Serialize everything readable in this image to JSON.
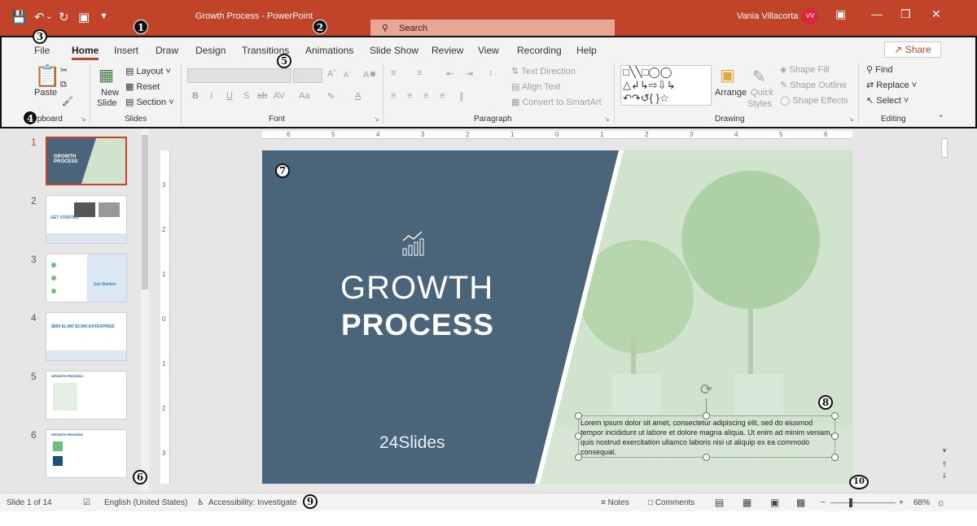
{
  "titlebar": {
    "doc_title": "Growth Process  -  PowerPoint",
    "search_placeholder": "Search",
    "user_name": "Vania Villacorta",
    "user_initials": "VV"
  },
  "badges": [
    "1",
    "2",
    "3",
    "4",
    "5",
    "6",
    "7",
    "8",
    "9",
    "10"
  ],
  "ribbon": {
    "tabs": [
      "File",
      "Home",
      "Insert",
      "Draw",
      "Design",
      "Transitions",
      "Animations",
      "Slide Show",
      "Review",
      "View",
      "Recording",
      "Help"
    ],
    "active_tab": "Home",
    "share_label": "Share",
    "clipboard": {
      "paste": "Paste",
      "group": "Clipboard"
    },
    "slides": {
      "new_slide_1": "New",
      "new_slide_2": "Slide",
      "layout": "Layout",
      "reset": "Reset",
      "section": "Section",
      "group": "Slides"
    },
    "font": {
      "group": "Font"
    },
    "paragraph": {
      "text_direction": "Text Direction",
      "align_text": "Align Text",
      "convert_smartart": "Convert to SmartArt",
      "group": "Paragraph"
    },
    "drawing": {
      "arrange": "Arrange",
      "quick_styles_1": "Quick",
      "quick_styles_2": "Styles",
      "shape_fill": "Shape Fill",
      "shape_outline": "Shape Outline",
      "shape_effects": "Shape Effects",
      "group": "Drawing"
    },
    "editing": {
      "find": "Find",
      "replace": "Replace",
      "select": "Select",
      "group": "Editing"
    }
  },
  "thumbnails": [
    {
      "num": "1",
      "title": "GROWTH PROCESS",
      "selected": true
    },
    {
      "num": "2",
      "title": "GET STARTED"
    },
    {
      "num": "3",
      "title": "Get Started"
    },
    {
      "num": "4",
      "title": "$899  $1,980  $3,980  ENTERPRISE"
    },
    {
      "num": "5",
      "title": "GROWTH PROCESS"
    },
    {
      "num": "6",
      "title": "GROWTH PROCESS"
    }
  ],
  "slide": {
    "title_line1": "GROWTH",
    "title_line2": "PROCESS",
    "logo": "24Slides",
    "body_text": "Lorem ipsum dolor sit amet, consectetur adipiscing elit, sed do eiusmod tempor incididunt ut labore et dolore magna aliqua. Ut enim ad minim veniam, quis nostrud exercitation ullamco laboris nisi ut aliquip ex ea commodo consequat."
  },
  "ruler": {
    "h_ticks": [
      "6",
      "5",
      "4",
      "3",
      "2",
      "1",
      "0",
      "1",
      "2",
      "3",
      "4",
      "5",
      "6"
    ],
    "v_ticks": [
      "3",
      "2",
      "1",
      "0",
      "1",
      "2",
      "3"
    ]
  },
  "statusbar": {
    "slide_count": "Slide 1 of 14",
    "language": "English (United States)",
    "accessibility": "Accessibility: Investigate",
    "notes": "Notes",
    "comments": "Comments",
    "zoom": "68%",
    "zoom_level": 0.68
  },
  "colors": {
    "accent": "#c0432a",
    "slide_dark": "#4a6479",
    "slide_green": "#cfe3cd"
  }
}
